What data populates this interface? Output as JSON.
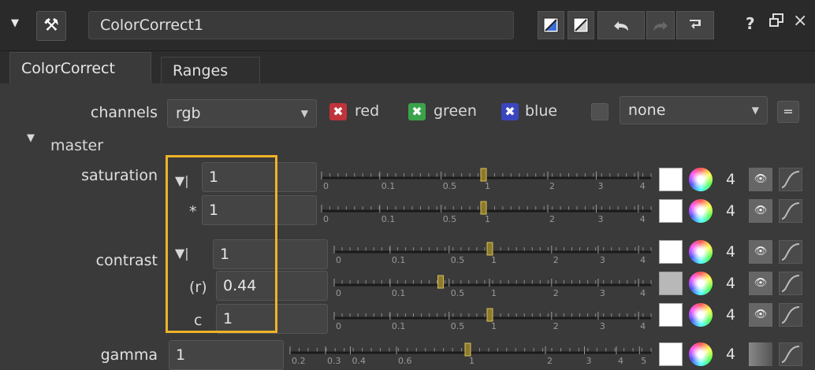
{
  "title_bar": {
    "node_name": "ColorCorrect1",
    "close_glyph": "×",
    "help_glyph": "?",
    "float_glyph": "🗗"
  },
  "tabs": [
    {
      "label": "ColorCorrect",
      "active": true
    },
    {
      "label": "Ranges",
      "active": false
    }
  ],
  "channels": {
    "label": "channels",
    "value": "rgb",
    "toggles": [
      {
        "label": "red",
        "checked": true,
        "color": "#c0333a"
      },
      {
        "label": "green",
        "checked": true,
        "color": "#3aa34a"
      },
      {
        "label": "blue",
        "checked": true,
        "color": "#3a46c0"
      }
    ],
    "extra_value": "none",
    "equals_label": "="
  },
  "master": {
    "label": "master",
    "saturation": {
      "label": "saturation",
      "rows": [
        {
          "prefix": "▼|",
          "value": "1",
          "slider_value": 1
        },
        {
          "prefix": "*",
          "value": "1",
          "slider_value": 1
        }
      ],
      "ticks": [
        "0",
        "0.1",
        "0.5",
        "1",
        "2",
        "3",
        "4"
      ]
    },
    "contrast": {
      "label": "contrast",
      "rows": [
        {
          "prefix": "▼|",
          "value": "1",
          "slider_value": 1
        },
        {
          "prefix": "(r)",
          "value": "0.44",
          "slider_value": 0.44
        },
        {
          "prefix": "c",
          "value": "1",
          "slider_value": 1
        }
      ],
      "ticks": [
        "0",
        "0.1",
        "0.5",
        "1",
        "2",
        "3",
        "4"
      ]
    },
    "gamma": {
      "label": "gamma",
      "value": "1",
      "slider_value": 1,
      "ticks": [
        "0.2",
        "0.3",
        "0.4",
        "0.6",
        "1",
        "2",
        "3",
        "4",
        "5"
      ]
    }
  },
  "row_icon_count_label": "4"
}
